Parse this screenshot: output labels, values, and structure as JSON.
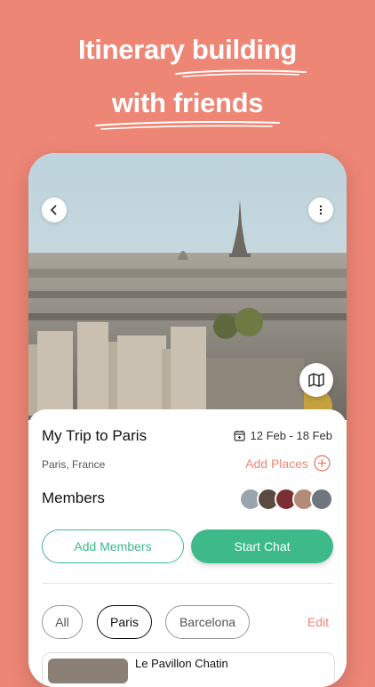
{
  "headline": {
    "line1": "Itinerary building",
    "line2": "with friends"
  },
  "trip": {
    "title": "My Trip to Paris",
    "dates": "12 Feb - 18 Feb",
    "location": "Paris, France",
    "add_places_label": "Add Places"
  },
  "members": {
    "label": "Members",
    "avatar_count": 5
  },
  "buttons": {
    "add_members": "Add Members",
    "start_chat": "Start Chat"
  },
  "filters": {
    "chips": [
      "All",
      "Paris",
      "Barcelona"
    ],
    "selected": "Paris",
    "edit_label": "Edit"
  },
  "place_list": {
    "first_item_name": "Le Pavillon Chatin"
  },
  "icons": [
    "back-icon",
    "more-icon",
    "map-icon",
    "calendar-icon",
    "plus-circle-icon"
  ],
  "colors": {
    "background": "#EE8676",
    "accent_green": "#3DB98A",
    "accent_coral": "#EE8676"
  }
}
